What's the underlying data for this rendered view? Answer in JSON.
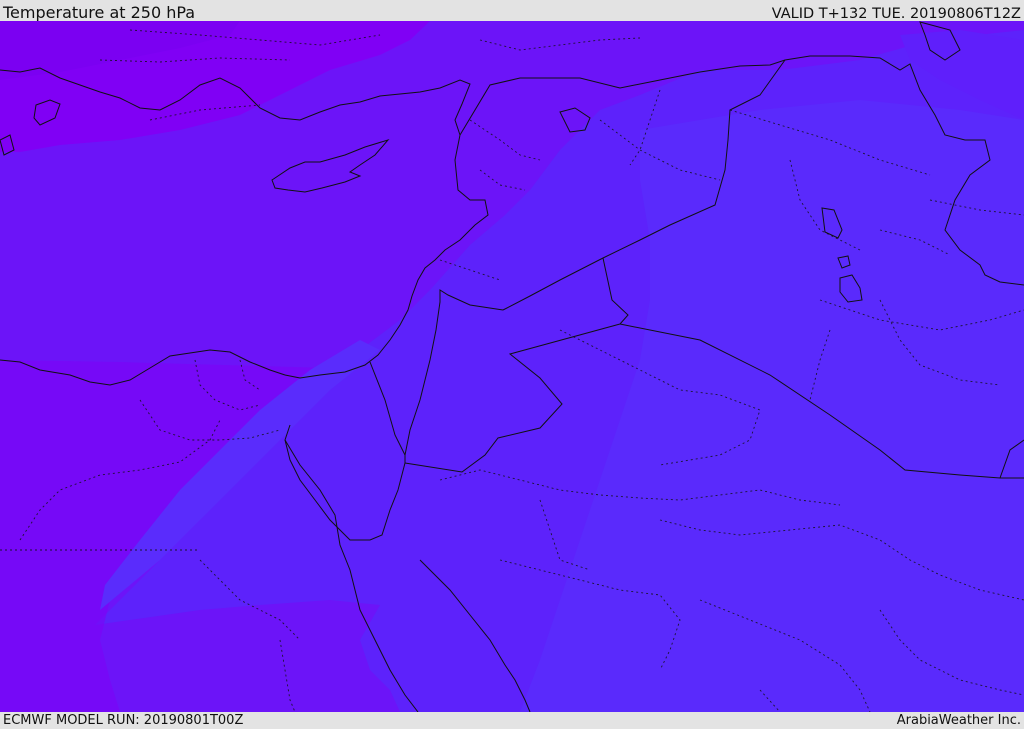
{
  "header": {
    "title": "Temperature at 250 hPa",
    "valid": "VALID T+132 TUE. 20190806T12Z"
  },
  "footer": {
    "model_run": "ECMWF MODEL RUN: 20190801T00Z",
    "brand": "ArabiaWeather Inc."
  },
  "colors": {
    "frame": "#e3e3e3",
    "temp_band_coldest": "#8000f5",
    "temp_band_cold": "#6c14f8",
    "temp_band_mid": "#5d22fb",
    "temp_band_warm": "#5a2afc",
    "border": "#111111"
  }
}
